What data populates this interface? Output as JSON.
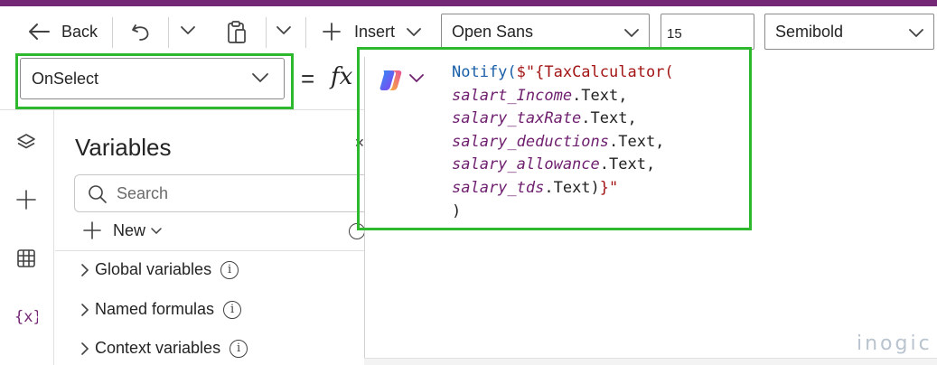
{
  "toolbar": {
    "back_label": "Back",
    "insert_label": "Insert",
    "font_family_value": "Open Sans",
    "font_size_value": "15",
    "font_weight_value": "Semibold"
  },
  "property_selector": {
    "value": "OnSelect",
    "equals": "=",
    "fx": "fx"
  },
  "left_panel": {
    "title": "Variables",
    "search_placeholder": "Search",
    "new_label": "New",
    "tree_items": [
      {
        "label": "Global variables"
      },
      {
        "label": "Named formulas"
      },
      {
        "label": "Context variables"
      }
    ]
  },
  "formula": {
    "l1_fn": "Notify(",
    "l1_str": "$\"{TaxCalculator(",
    "l2_var": "salart_Income",
    "l2_prop": ".Text,",
    "l3_var": "salary_taxRate",
    "l3_prop": ".Text,",
    "l4_var": "salary_deductions",
    "l4_prop": ".Text,",
    "l5_var": "salary_allowance",
    "l5_prop": ".Text,",
    "l6_var": "salary_tds",
    "l6_prop": ".Text)",
    "l6_str": "}\"",
    "l7": ")"
  },
  "watermark": "inogic",
  "colors": {
    "brand_bar": "#742774",
    "highlight": "#2db82d",
    "function": "#1a5fa8",
    "string": "#a31515",
    "variable": "#6e1f6e"
  }
}
